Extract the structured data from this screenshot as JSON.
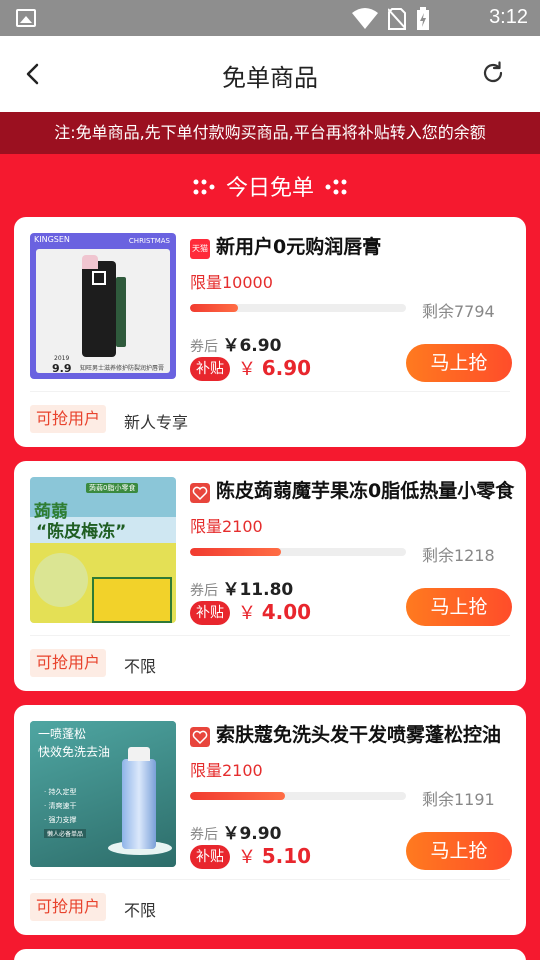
{
  "status_bar": {
    "time": "3:12"
  },
  "header": {
    "title": "免单商品"
  },
  "notice": {
    "text": "注:免单商品,先下单付款购买商品,平台再将补贴转入您的余额"
  },
  "section": {
    "title": "今日免单"
  },
  "products": [
    {
      "name": "新用户0元购润唇膏",
      "badge": "天猫",
      "limit": "限量10000",
      "progress": 0.22,
      "remaining": "剩余7794",
      "after_label": "券后",
      "after_price": "￥6.90",
      "subsidy_label": "补贴",
      "subsidy_currency": "￥",
      "subsidy_price": "6.90",
      "button": "马上抢",
      "user_label": "可抢用户",
      "user_value": "新人专享",
      "thumb_texts": [
        "KINGSEN",
        "CHRISTMAS",
        "2019",
        "9.9",
        "知旺男士滋养修护防裂润护唇膏"
      ]
    },
    {
      "name": "陈皮蒟蒻魔芋果冻0脂低热量小零食",
      "badge": "",
      "limit": "限量2100",
      "progress": 0.42,
      "remaining": "剩余1218",
      "after_label": "券后",
      "after_price": "￥11.80",
      "subsidy_label": "补贴",
      "subsidy_currency": "￥",
      "subsidy_price": "4.00",
      "button": "马上抢",
      "user_label": "可抢用户",
      "user_value": "不限",
      "thumb_texts": [
        "蒟蒻",
        "“陈皮梅冻”",
        "蒟蒻0脂小零食"
      ]
    },
    {
      "name": "索肤蔻免洗头发干发喷雾蓬松控油",
      "badge": "",
      "limit": "限量2100",
      "progress": 0.44,
      "remaining": "剩余1191",
      "after_label": "券后",
      "after_price": "￥9.90",
      "subsidy_label": "补贴",
      "subsidy_currency": "￥",
      "subsidy_price": "5.10",
      "button": "马上抢",
      "user_label": "可抢用户",
      "user_value": "不限",
      "thumb_texts": [
        "一喷蓬松",
        "快效免洗去油",
        "· 持久定型",
        "· 清爽速干",
        "· 强力支撑",
        "懒人必备单品"
      ]
    }
  ]
}
